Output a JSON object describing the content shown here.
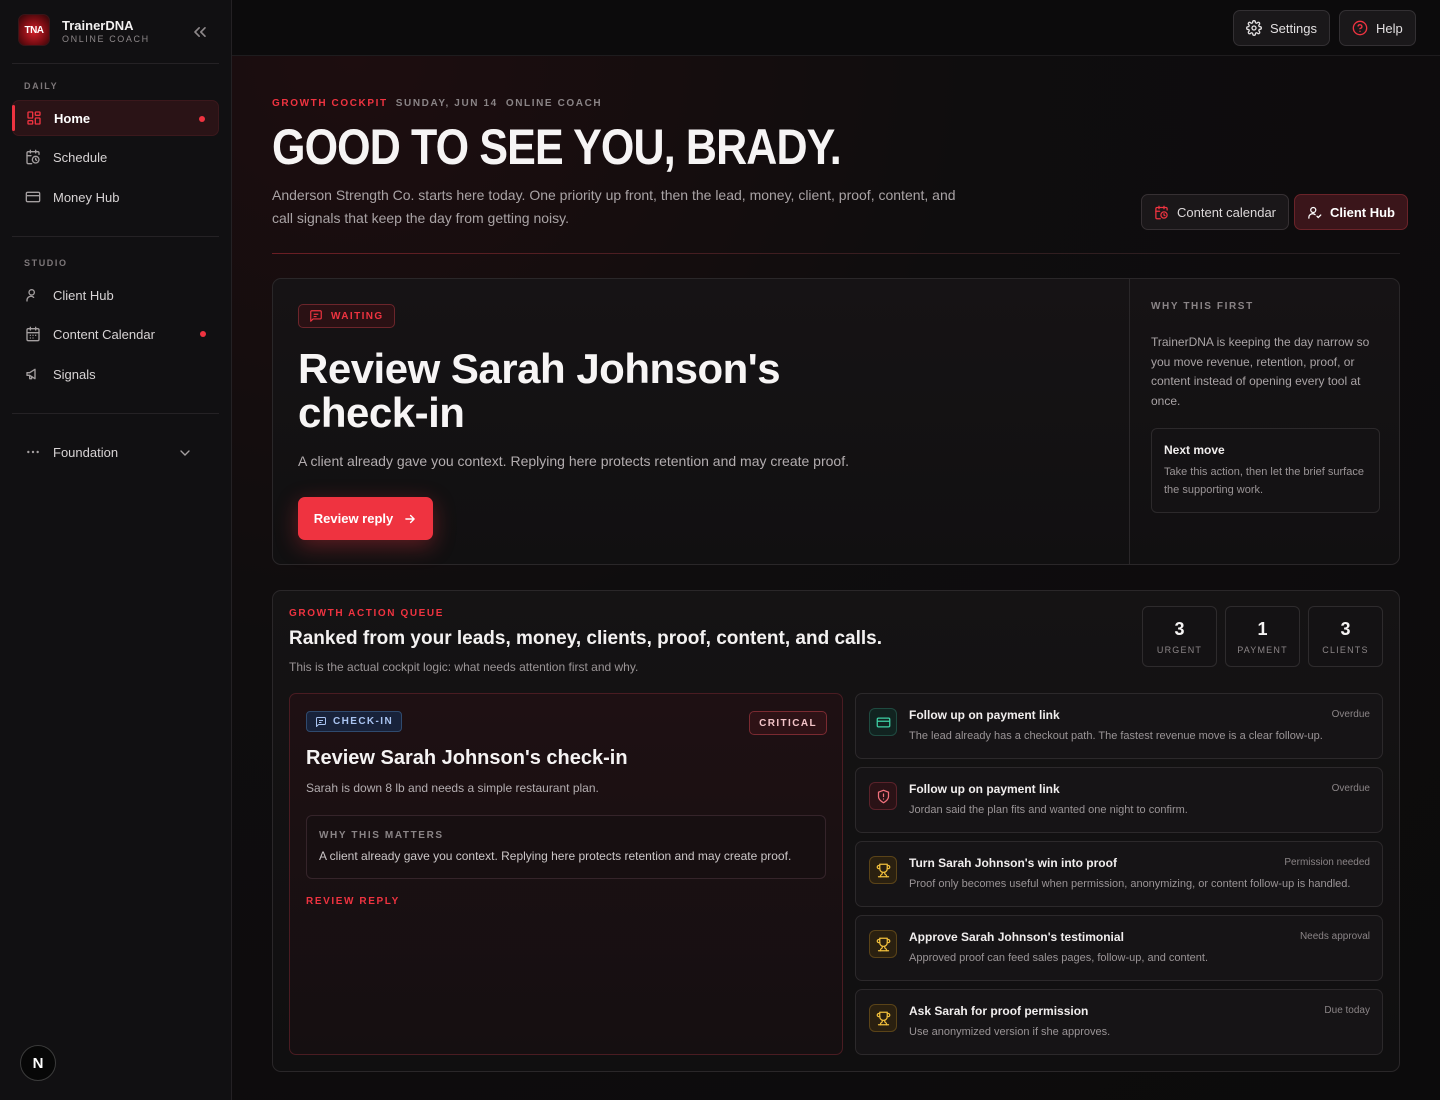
{
  "brand": {
    "name": "TrainerDNA",
    "subtitle": "ONLINE COACH",
    "logo_text": "TNA"
  },
  "sidebar": {
    "daily_label": "DAILY",
    "studio_label": "STUDIO",
    "daily_items": [
      {
        "label": "Home",
        "icon": "grid-icon",
        "active": true,
        "dot": true
      },
      {
        "label": "Schedule",
        "icon": "calendar-clock-icon"
      },
      {
        "label": "Money Hub",
        "icon": "credit-card-icon"
      }
    ],
    "studio_items": [
      {
        "label": "Client Hub",
        "icon": "user-icon"
      },
      {
        "label": "Content Calendar",
        "icon": "calendar-icon",
        "dot": true
      },
      {
        "label": "Signals",
        "icon": "megaphone-icon"
      }
    ],
    "foundation_label": "Foundation",
    "avatar_letter": "N"
  },
  "topbar": {
    "settings_label": "Settings",
    "help_label": "Help"
  },
  "hero": {
    "eyebrow_primary": "GROWTH COCKPIT",
    "eyebrow_date": "SUNDAY, JUN 14",
    "eyebrow_role": "ONLINE COACH",
    "title": "GOOD TO SEE YOU, BRADY.",
    "description": "Anderson Strength Co. starts here today. One priority up front, then the lead, money, client, proof, content, and call signals that keep the day from getting noisy.",
    "content_calendar_label": "Content calendar",
    "client_hub_label": "Client Hub"
  },
  "priority": {
    "badge": "WAITING",
    "title": "Review Sarah Johnson's check-in",
    "description": "A client already gave you context. Replying here protects retention and may create proof.",
    "button_label": "Review reply",
    "why_label": "WHY THIS FIRST",
    "why_text": "TrainerDNA is keeping the day narrow so you move revenue, retention, proof, or content instead of opening every tool at once.",
    "next_title": "Next move",
    "next_text": "Take this action, then let the brief surface the supporting work."
  },
  "queue": {
    "label": "GROWTH ACTION QUEUE",
    "title": "Ranked from your leads, money, clients, proof, content, and calls.",
    "subtitle": "This is the actual cockpit logic: what needs attention first and why.",
    "stats": [
      {
        "value": "3",
        "label": "URGENT"
      },
      {
        "value": "1",
        "label": "PAYMENT"
      },
      {
        "value": "3",
        "label": "CLIENTS"
      }
    ],
    "featured": {
      "badge": "CHECK-IN",
      "severity": "CRITICAL",
      "title": "Review Sarah Johnson's check-in",
      "description": "Sarah is down 8 lb and needs a simple restaurant plan.",
      "why_label": "WHY THIS MATTERS",
      "why_text": "A client already gave you context. Replying here protects retention and may create proof.",
      "link": "REVIEW REPLY"
    },
    "tasks": [
      {
        "title": "Follow up on payment link",
        "description": "The lead already has a checkout path. The fastest revenue move is a clear follow-up.",
        "status": "Overdue",
        "icon": "card-icon",
        "tone": "green"
      },
      {
        "title": "Follow up on payment link",
        "description": "Jordan said the plan fits and wanted one night to confirm.",
        "status": "Overdue",
        "icon": "shield-icon",
        "tone": "red"
      },
      {
        "title": "Turn Sarah Johnson's win into proof",
        "description": "Proof only becomes useful when permission, anonymizing, or content follow-up is handled.",
        "status": "Permission needed",
        "icon": "trophy-icon",
        "tone": "gold"
      },
      {
        "title": "Approve Sarah Johnson's testimonial",
        "description": "Approved proof can feed sales pages, follow-up, and content.",
        "status": "Needs approval",
        "icon": "trophy-icon",
        "tone": "gold"
      },
      {
        "title": "Ask Sarah for proof permission",
        "description": "Use anonymized version if she approves.",
        "status": "Due today",
        "icon": "trophy-icon",
        "tone": "gold"
      }
    ]
  },
  "colors": {
    "accent": "#ef3340",
    "background": "#0d0b0c",
    "panel": "#161315"
  }
}
